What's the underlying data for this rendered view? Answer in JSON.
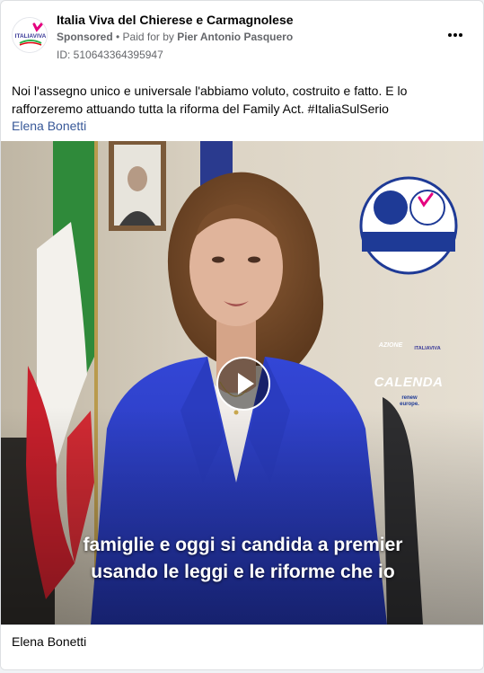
{
  "post": {
    "page_name": "Italia Viva del Chierese e Carmagnolese",
    "sponsored_label": "Sponsored",
    "paid_prefix": " • Paid for by ",
    "payer": "Pier Antonio Pasquero",
    "ad_id": "ID: 510643364395947",
    "more_icon": "more-options-icon",
    "body_text": "Noi l'assegno unico e universale l'abbiamo voluto, costruito e fatto. E lo rafforzeremo attuando tutta la riforma del Family Act. #ItaliaSulSerio",
    "body_link": "Elena Bonetti"
  },
  "avatar": {
    "logo_text": "ITALIAVIVA"
  },
  "video": {
    "subtitle_line1": "famiglie e oggi si candida a premier",
    "subtitle_line2": "usando le leggi e le riforme che io",
    "badge": {
      "left_logo": "AZIONE",
      "right_logo": "ITALIAVIVA",
      "name": "CALENDA",
      "tagline_line1": "renew",
      "tagline_line2": "europe."
    },
    "play_icon": "play-icon"
  },
  "footer": {
    "title": "Elena Bonetti"
  },
  "colors": {
    "link": "#385898",
    "secondary_text": "#65676b",
    "badge_blue": "#1e3a96",
    "jacket_blue": "#2c3fc4",
    "italia_viva_pink": "#e5007e"
  }
}
